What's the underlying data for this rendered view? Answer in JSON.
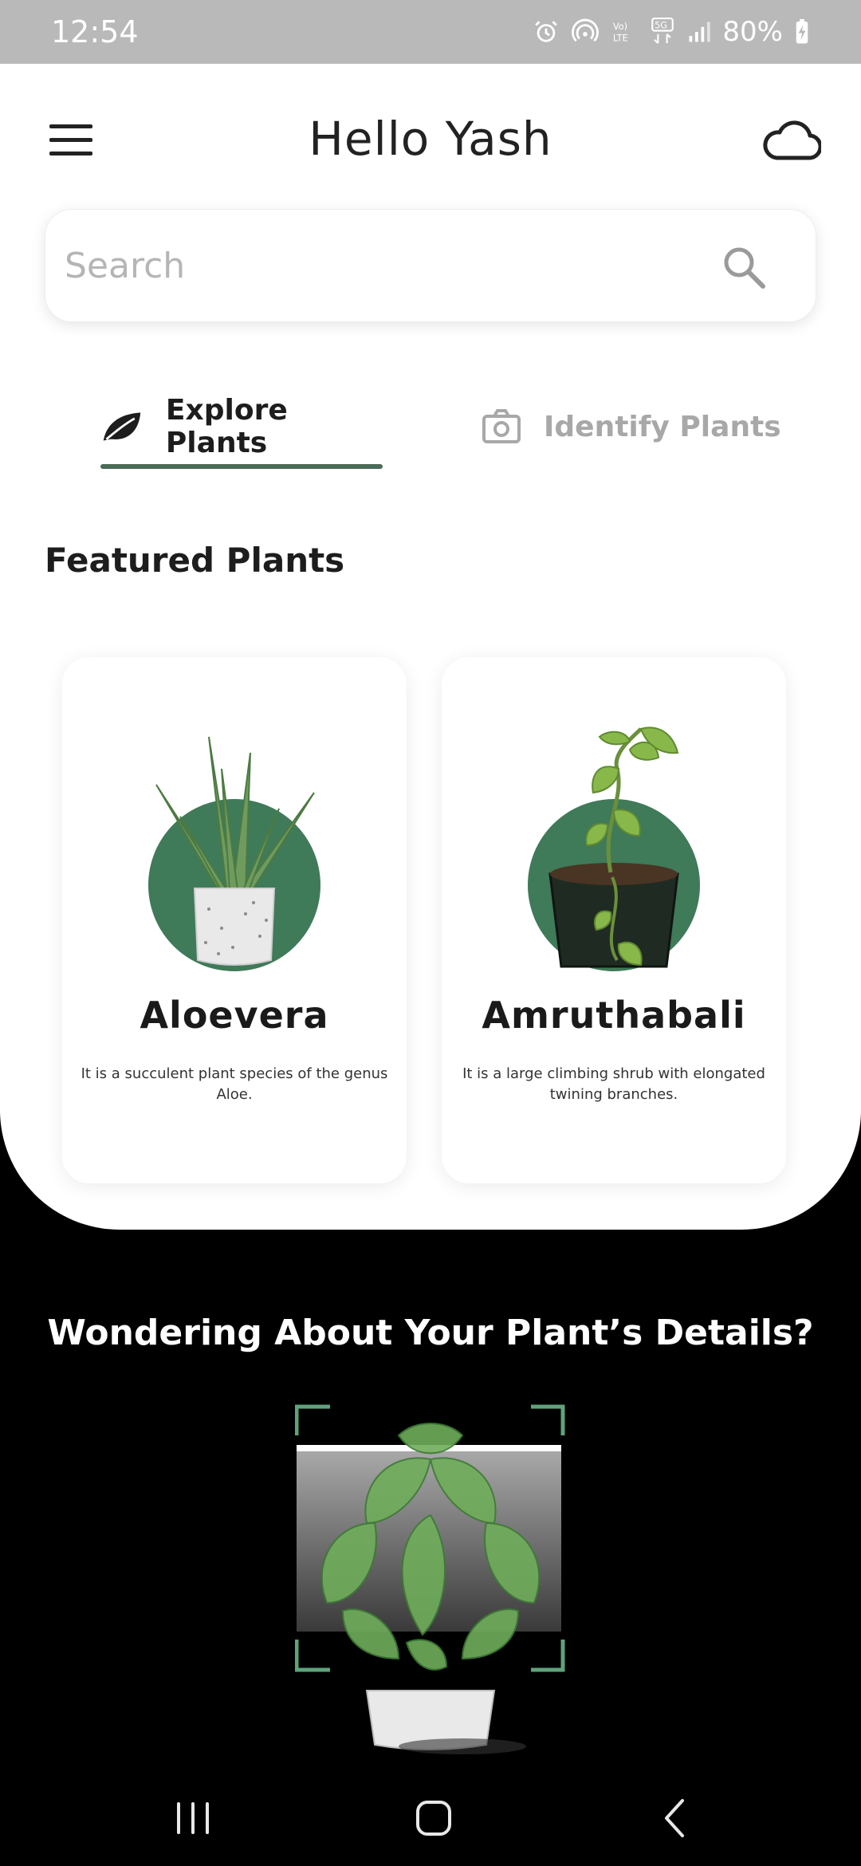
{
  "status_bar": {
    "time": "12:54",
    "battery": "80%"
  },
  "header": {
    "title": "Hello Yash"
  },
  "search": {
    "placeholder": "Search"
  },
  "tabs": [
    {
      "label": "Explore Plants",
      "active": true
    },
    {
      "label": "Identify Plants",
      "active": false
    }
  ],
  "featured": {
    "title": "Featured Plants",
    "plants": [
      {
        "name": "Aloevera",
        "description": "It is a succulent plant species of the genus Aloe."
      },
      {
        "name": "Amruthabali",
        "description": "It is a large climbing shrub with elongated twining branches."
      }
    ]
  },
  "cta": {
    "title": "Wondering About Your Plant’s Details?"
  },
  "colors": {
    "accent": "#4a6b57",
    "plant_circle": "#3f7a59",
    "scanner_frame": "#5fa37a"
  }
}
